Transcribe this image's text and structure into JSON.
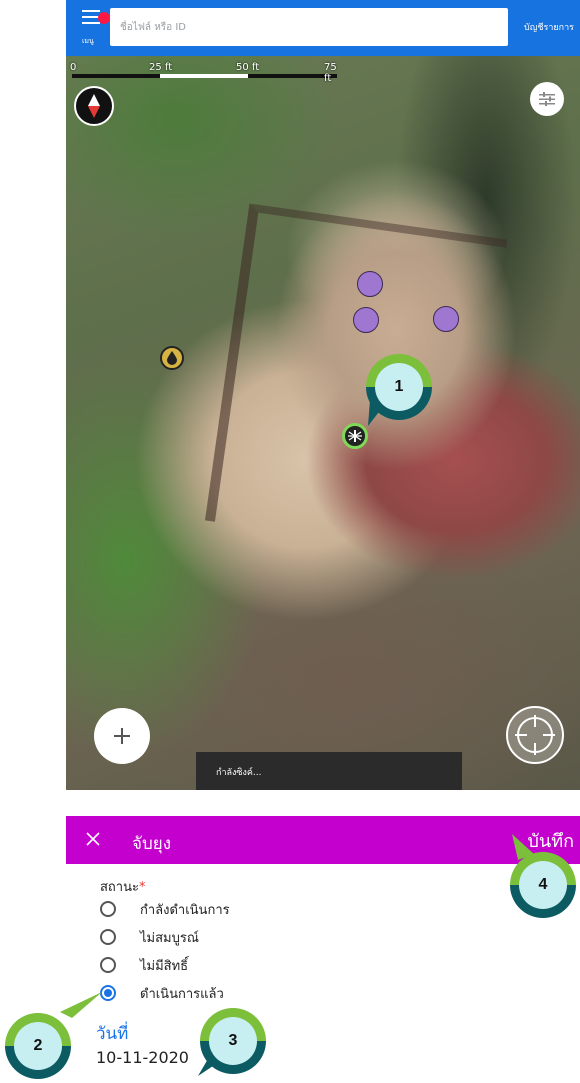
{
  "topbar": {
    "menu_label": "เมนู",
    "search_placeholder": "ชื่อไฟล์ หรือ ID",
    "list_link": "บัญชีรายการ"
  },
  "map": {
    "scale_labels": [
      "0",
      "25 ft",
      "50 ft",
      "75 ft"
    ],
    "sync_toast": "กำลังซิงค์...",
    "icons": {
      "compass": "compass-icon",
      "filter": "sliders-icon",
      "zoom": "plus-icon",
      "locate": "crosshair-icon",
      "oil": "drop-icon",
      "bug": "mosquito-icon"
    }
  },
  "form": {
    "title": "จับยุง",
    "save_label": "บันทึก",
    "status_label": "สถานะ",
    "status_options": [
      {
        "label": "กำลังดำเนินการ",
        "selected": false
      },
      {
        "label": "ไม่สมบูรณ์",
        "selected": false
      },
      {
        "label": "ไม่มีสิทธิ์",
        "selected": false
      },
      {
        "label": "ดำเนินการแล้ว",
        "selected": true
      }
    ],
    "date_label": "วันที่",
    "date_value": "10-11-2020"
  },
  "callouts": [
    "1",
    "2",
    "3",
    "4"
  ],
  "colors": {
    "appbar": "#1673e0",
    "sheet_bar": "#c400ce",
    "accent": "#1a73e8",
    "callout_top": "#7bbf3b",
    "callout_bottom": "#0c5b63"
  }
}
